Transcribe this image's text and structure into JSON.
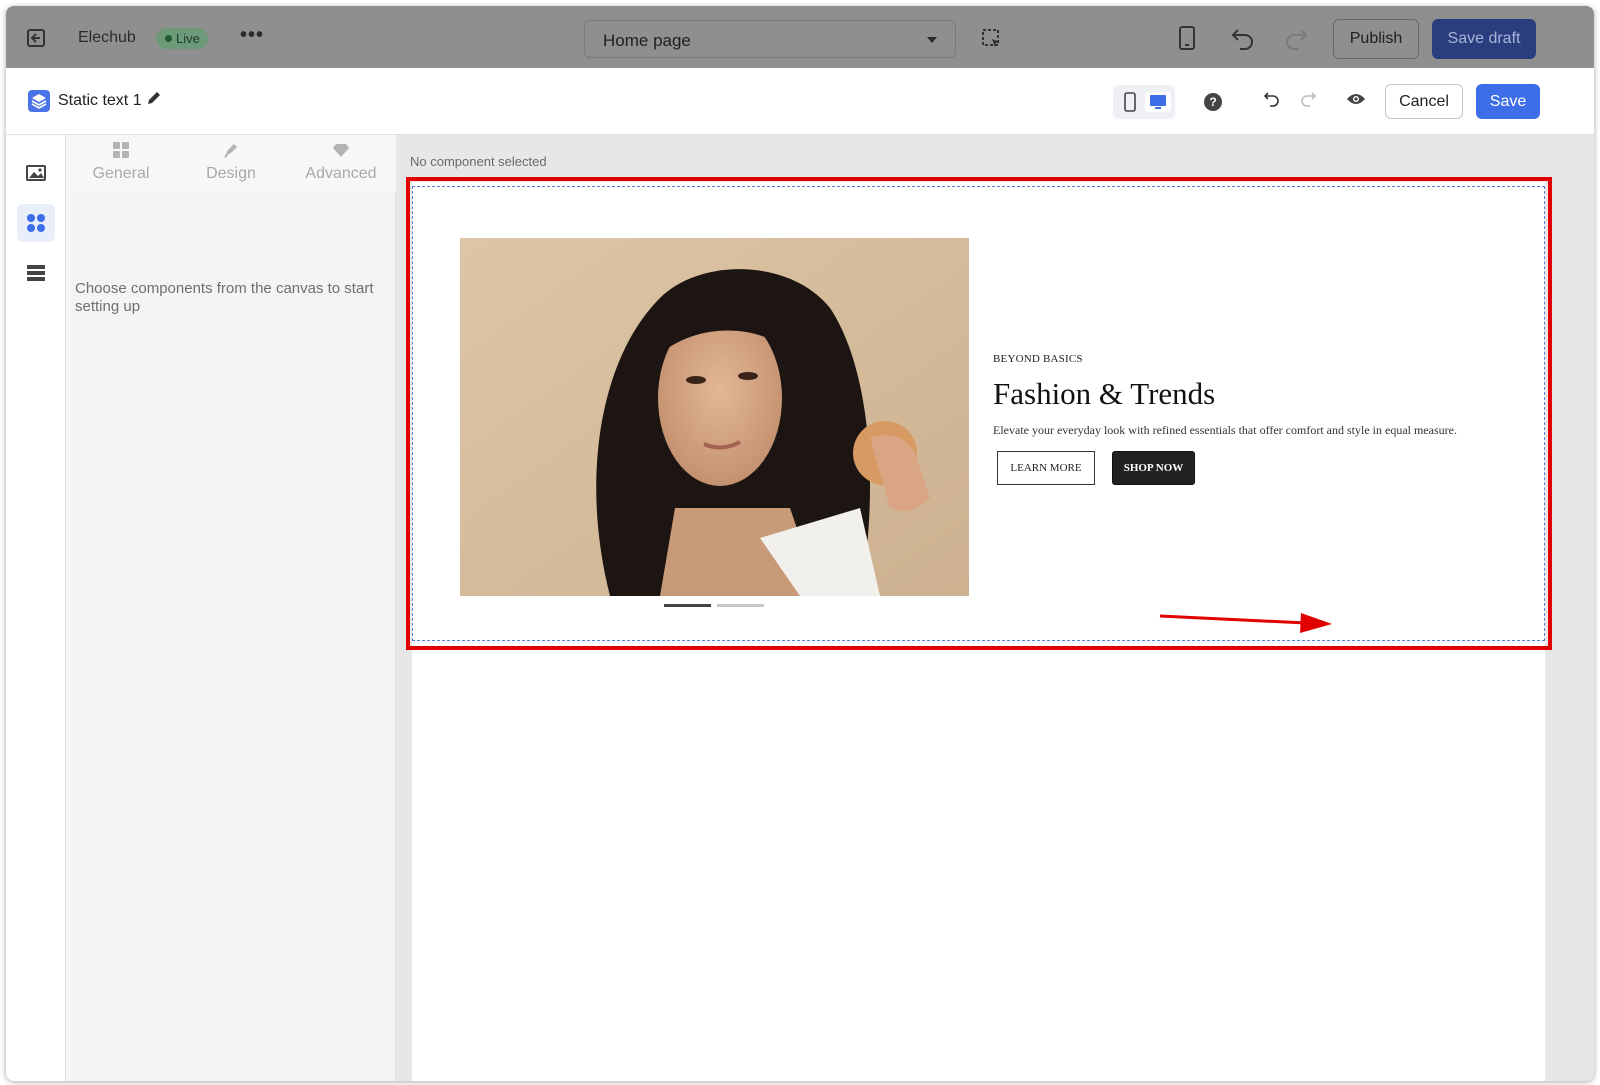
{
  "topbar": {
    "store_name": "Elechub",
    "status_badge": "Live",
    "more_label": "•••",
    "page_select_value": "Home page",
    "publish_label": "Publish",
    "save_draft_label": "Save draft"
  },
  "editor": {
    "component_title": "Static text 1",
    "help_label": "?",
    "cancel_label": "Cancel",
    "save_label": "Save"
  },
  "settings": {
    "tabs": [
      {
        "label": "General",
        "icon": "grid-icon"
      },
      {
        "label": "Design",
        "icon": "brush-icon"
      },
      {
        "label": "Advanced",
        "icon": "gem-icon"
      }
    ],
    "empty_hint": "Choose components from the canvas to start setting up"
  },
  "canvas": {
    "status": "No component selected",
    "hero": {
      "eyebrow": "BEYOND BASICS",
      "title": "Fashion & Trends",
      "description": "Elevate your everyday look with refined essentials that offer comfort and style in equal measure.",
      "learn_more_label": "LEARN MORE",
      "shop_now_label": "SHOP NOW",
      "slide_count": 2,
      "active_slide": 1
    }
  },
  "colors": {
    "accent": "#3d6ee8",
    "annotation": "#e00000",
    "save_draft_bg": "#2a3d7f"
  }
}
